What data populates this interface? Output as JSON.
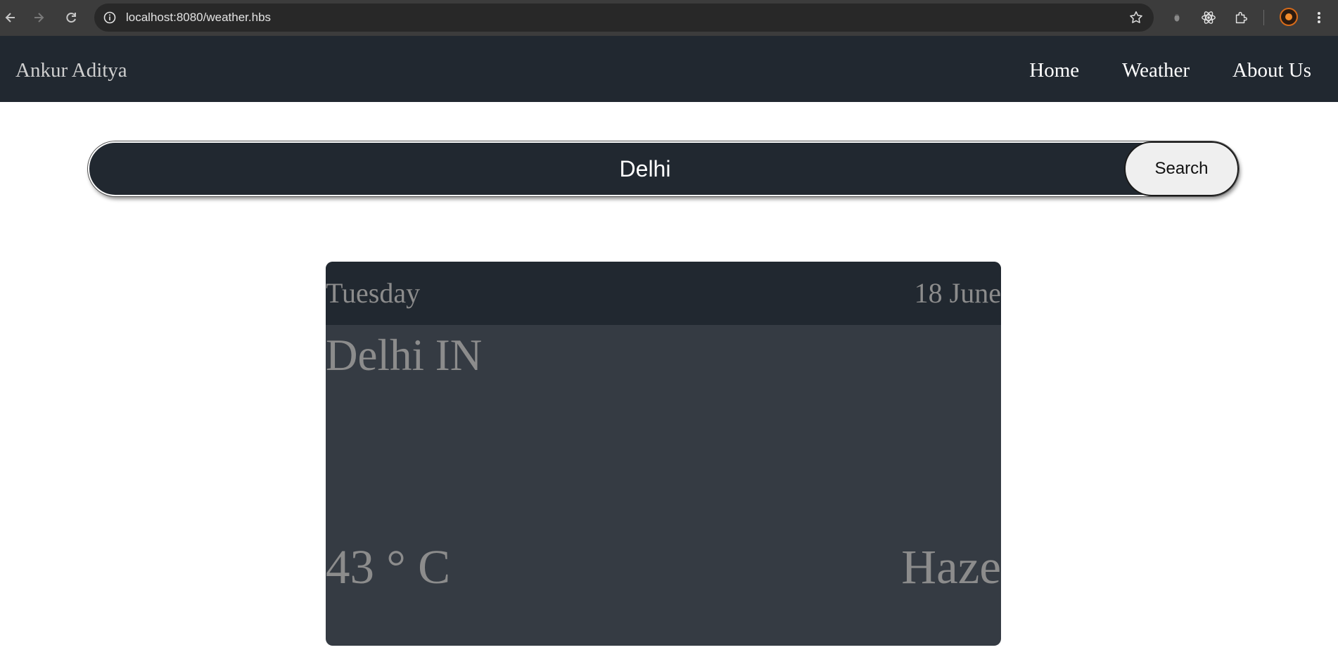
{
  "browser": {
    "url": "localhost:8080/weather.hbs",
    "icons": [
      "back-icon",
      "forward-icon",
      "reload-icon",
      "site-info-icon",
      "bookmark-star-icon",
      "extension-icon",
      "react-devtools-icon",
      "puzzle-icon",
      "profile-avatar",
      "menu-icon"
    ]
  },
  "navbar": {
    "brand": "Ankur Aditya",
    "links": [
      "Home",
      "Weather",
      "About Us"
    ]
  },
  "search": {
    "value": "Delhi",
    "button_label": "Search"
  },
  "weather": {
    "day": "Tuesday",
    "date": "18 June",
    "location": "Delhi IN",
    "temperature": "43 ° C",
    "condition": "Haze"
  },
  "colors": {
    "navbar_bg": "#212830",
    "card_bg": "#353b43",
    "card_text": "#8c8c8c"
  }
}
